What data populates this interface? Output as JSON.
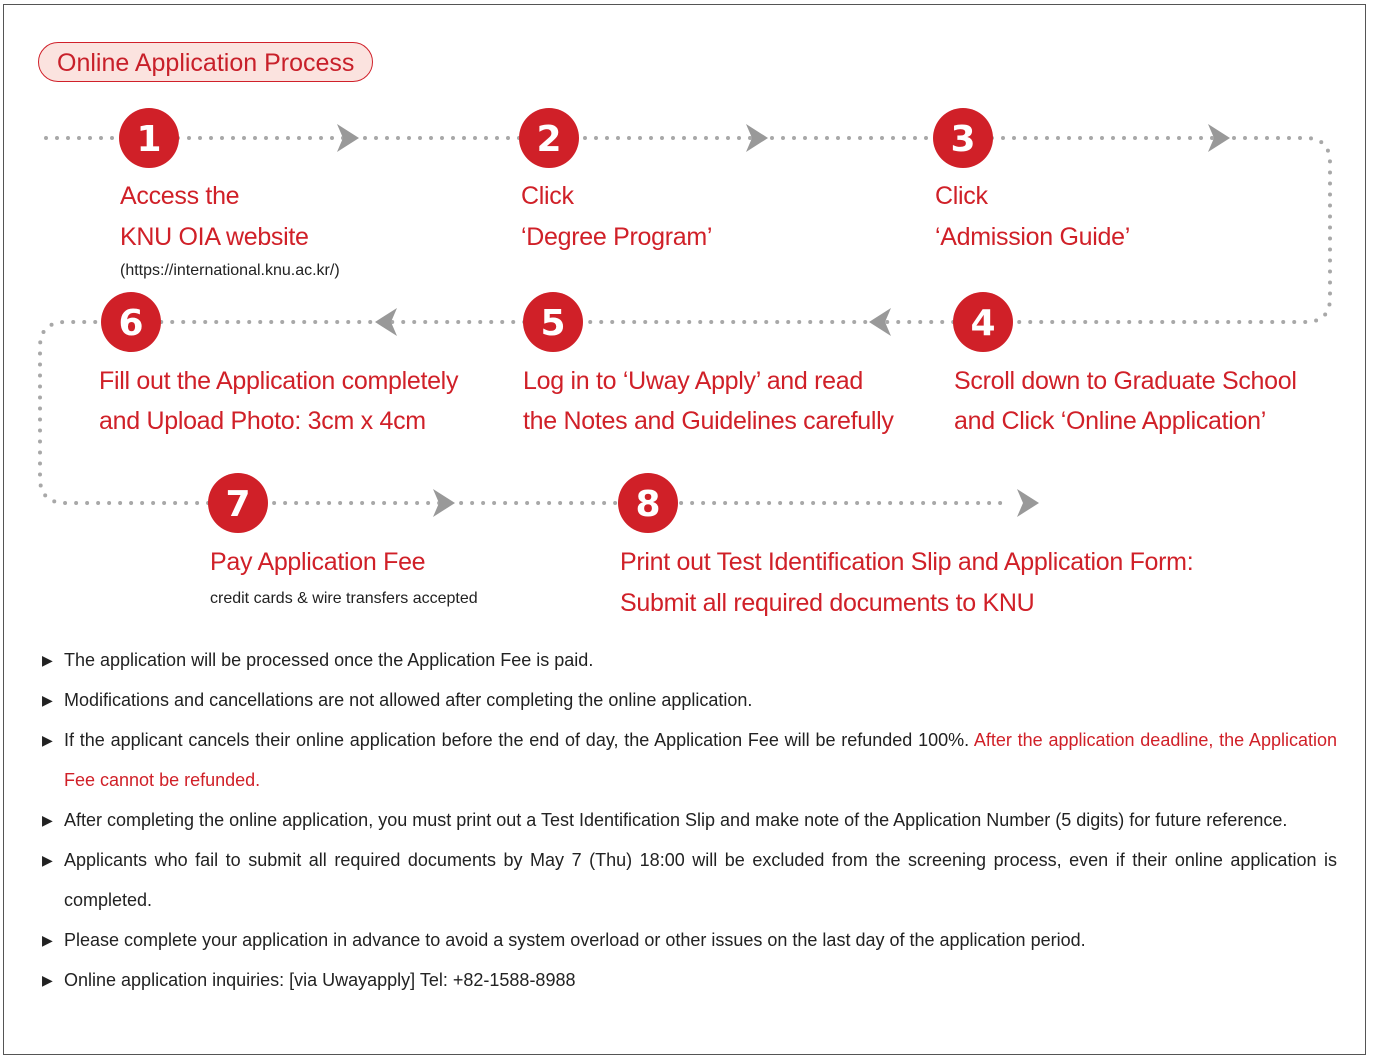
{
  "title": "Online Application Process",
  "steps": [
    {
      "number": "1",
      "line1": "Access the",
      "line2": "KNU OIA website",
      "sub": "(https://international.knu.ac.kr/)"
    },
    {
      "number": "2",
      "line1": "Click",
      "line2": "‘Degree Program’"
    },
    {
      "number": "3",
      "line1": "Click",
      "line2": "‘Admission Guide’"
    },
    {
      "number": "4",
      "line1": "Scroll down to Graduate School",
      "line2": "and Click ‘Online Application’"
    },
    {
      "number": "5",
      "line1": "Log in to ‘Uway Apply’ and read",
      "line2": "the Notes and Guidelines carefully"
    },
    {
      "number": "6",
      "line1": "Fill out the Application completely",
      "line2": "and Upload Photo: 3cm x 4cm"
    },
    {
      "number": "7",
      "line1": "Pay Application Fee",
      "sub": "credit cards & wire transfers accepted"
    },
    {
      "number": "8",
      "line1": "Print out Test Identification Slip and Application Form:",
      "line2": "Submit all required documents to KNU"
    }
  ],
  "notes": [
    {
      "text": "The application will be processed once the Application Fee is paid."
    },
    {
      "text": "Modifications and cancellations are not allowed after completing the online application."
    },
    {
      "text": "If the applicant cancels their online application before the end of day, the Application Fee will be refunded 100%. ",
      "highlight": "After the application deadline, the Application Fee cannot be refunded."
    },
    {
      "text": "After completing the online application, you must print out a Test Identification Slip and make note of the Application Number (5 digits) for future reference."
    },
    {
      "text": "Applicants who fail to submit all required documents by May 7 (Thu) 18:00 will be excluded from the screening process, even if their online application is completed."
    },
    {
      "text": "Please complete your application in advance to avoid a system overload or other issues on the last day of the application period."
    },
    {
      "text": "Online application inquiries: [via Uwayapply] Tel: +82-1588-8988"
    }
  ],
  "colors": {
    "accent": "#d02028",
    "pill_bg": "#fbe3df",
    "dots": "#a8a8a8"
  },
  "icons": {
    "bullet": "right-triangle-icon",
    "arrow": "chevron-arrow-icon"
  }
}
